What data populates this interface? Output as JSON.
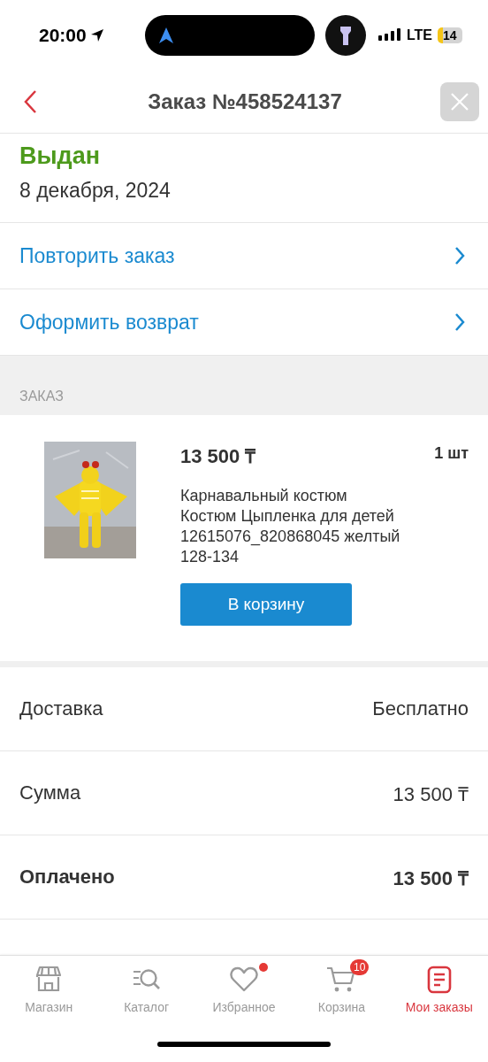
{
  "status_bar": {
    "time": "20:00",
    "network": "LTE",
    "battery": "14"
  },
  "header": {
    "title": "Заказ №458524137"
  },
  "order_status": {
    "label": "Выдан",
    "date": "8 декабря, 2024"
  },
  "actions": [
    {
      "label": "Повторить заказ"
    },
    {
      "label": "Оформить возврат"
    }
  ],
  "section_title": "ЗАКАЗ",
  "item": {
    "price": "13 500 ₸",
    "quantity": "1 шт",
    "name": "Карнавальный костюм\nКостюм Цыпленка для детей\n12615076_820868045 желтый\n128-134",
    "button": "В корзину"
  },
  "summary": [
    {
      "label": "Доставка",
      "value": "Бесплатно",
      "bold": false
    },
    {
      "label": "Сумма",
      "value": "13 500 ₸",
      "bold": false
    },
    {
      "label": "Оплачено",
      "value": "13 500 ₸",
      "bold": true
    }
  ],
  "tab_bar": [
    {
      "label": "Магазин",
      "selected": false
    },
    {
      "label": "Каталог",
      "selected": false
    },
    {
      "label": "Избранное",
      "selected": false,
      "dot": true
    },
    {
      "label": "Корзина",
      "selected": false,
      "badge": "10"
    },
    {
      "label": "Мои заказы",
      "selected": true
    }
  ]
}
